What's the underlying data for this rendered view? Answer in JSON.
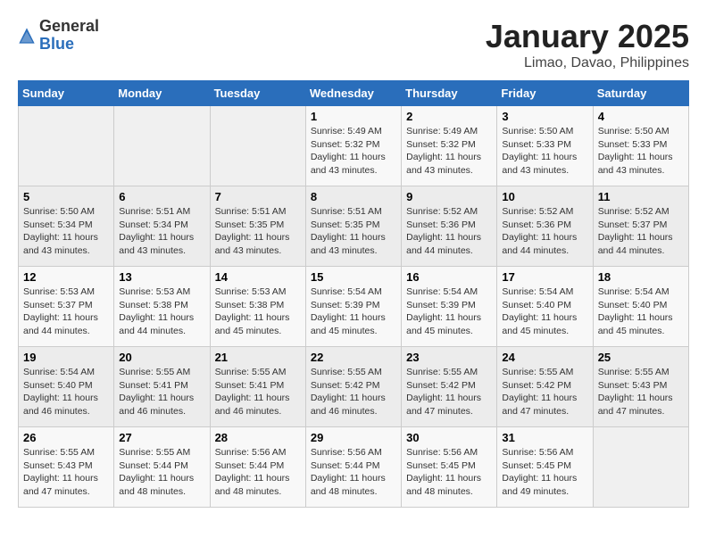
{
  "header": {
    "logo_general": "General",
    "logo_blue": "Blue",
    "month_title": "January 2025",
    "location": "Limao, Davao, Philippines"
  },
  "weekdays": [
    "Sunday",
    "Monday",
    "Tuesday",
    "Wednesday",
    "Thursday",
    "Friday",
    "Saturday"
  ],
  "weeks": [
    [
      {
        "day": "",
        "info": ""
      },
      {
        "day": "",
        "info": ""
      },
      {
        "day": "",
        "info": ""
      },
      {
        "day": "1",
        "info": "Sunrise: 5:49 AM\nSunset: 5:32 PM\nDaylight: 11 hours\nand 43 minutes."
      },
      {
        "day": "2",
        "info": "Sunrise: 5:49 AM\nSunset: 5:32 PM\nDaylight: 11 hours\nand 43 minutes."
      },
      {
        "day": "3",
        "info": "Sunrise: 5:50 AM\nSunset: 5:33 PM\nDaylight: 11 hours\nand 43 minutes."
      },
      {
        "day": "4",
        "info": "Sunrise: 5:50 AM\nSunset: 5:33 PM\nDaylight: 11 hours\nand 43 minutes."
      }
    ],
    [
      {
        "day": "5",
        "info": "Sunrise: 5:50 AM\nSunset: 5:34 PM\nDaylight: 11 hours\nand 43 minutes."
      },
      {
        "day": "6",
        "info": "Sunrise: 5:51 AM\nSunset: 5:34 PM\nDaylight: 11 hours\nand 43 minutes."
      },
      {
        "day": "7",
        "info": "Sunrise: 5:51 AM\nSunset: 5:35 PM\nDaylight: 11 hours\nand 43 minutes."
      },
      {
        "day": "8",
        "info": "Sunrise: 5:51 AM\nSunset: 5:35 PM\nDaylight: 11 hours\nand 43 minutes."
      },
      {
        "day": "9",
        "info": "Sunrise: 5:52 AM\nSunset: 5:36 PM\nDaylight: 11 hours\nand 44 minutes."
      },
      {
        "day": "10",
        "info": "Sunrise: 5:52 AM\nSunset: 5:36 PM\nDaylight: 11 hours\nand 44 minutes."
      },
      {
        "day": "11",
        "info": "Sunrise: 5:52 AM\nSunset: 5:37 PM\nDaylight: 11 hours\nand 44 minutes."
      }
    ],
    [
      {
        "day": "12",
        "info": "Sunrise: 5:53 AM\nSunset: 5:37 PM\nDaylight: 11 hours\nand 44 minutes."
      },
      {
        "day": "13",
        "info": "Sunrise: 5:53 AM\nSunset: 5:38 PM\nDaylight: 11 hours\nand 44 minutes."
      },
      {
        "day": "14",
        "info": "Sunrise: 5:53 AM\nSunset: 5:38 PM\nDaylight: 11 hours\nand 45 minutes."
      },
      {
        "day": "15",
        "info": "Sunrise: 5:54 AM\nSunset: 5:39 PM\nDaylight: 11 hours\nand 45 minutes."
      },
      {
        "day": "16",
        "info": "Sunrise: 5:54 AM\nSunset: 5:39 PM\nDaylight: 11 hours\nand 45 minutes."
      },
      {
        "day": "17",
        "info": "Sunrise: 5:54 AM\nSunset: 5:40 PM\nDaylight: 11 hours\nand 45 minutes."
      },
      {
        "day": "18",
        "info": "Sunrise: 5:54 AM\nSunset: 5:40 PM\nDaylight: 11 hours\nand 45 minutes."
      }
    ],
    [
      {
        "day": "19",
        "info": "Sunrise: 5:54 AM\nSunset: 5:40 PM\nDaylight: 11 hours\nand 46 minutes."
      },
      {
        "day": "20",
        "info": "Sunrise: 5:55 AM\nSunset: 5:41 PM\nDaylight: 11 hours\nand 46 minutes."
      },
      {
        "day": "21",
        "info": "Sunrise: 5:55 AM\nSunset: 5:41 PM\nDaylight: 11 hours\nand 46 minutes."
      },
      {
        "day": "22",
        "info": "Sunrise: 5:55 AM\nSunset: 5:42 PM\nDaylight: 11 hours\nand 46 minutes."
      },
      {
        "day": "23",
        "info": "Sunrise: 5:55 AM\nSunset: 5:42 PM\nDaylight: 11 hours\nand 47 minutes."
      },
      {
        "day": "24",
        "info": "Sunrise: 5:55 AM\nSunset: 5:42 PM\nDaylight: 11 hours\nand 47 minutes."
      },
      {
        "day": "25",
        "info": "Sunrise: 5:55 AM\nSunset: 5:43 PM\nDaylight: 11 hours\nand 47 minutes."
      }
    ],
    [
      {
        "day": "26",
        "info": "Sunrise: 5:55 AM\nSunset: 5:43 PM\nDaylight: 11 hours\nand 47 minutes."
      },
      {
        "day": "27",
        "info": "Sunrise: 5:55 AM\nSunset: 5:44 PM\nDaylight: 11 hours\nand 48 minutes."
      },
      {
        "day": "28",
        "info": "Sunrise: 5:56 AM\nSunset: 5:44 PM\nDaylight: 11 hours\nand 48 minutes."
      },
      {
        "day": "29",
        "info": "Sunrise: 5:56 AM\nSunset: 5:44 PM\nDaylight: 11 hours\nand 48 minutes."
      },
      {
        "day": "30",
        "info": "Sunrise: 5:56 AM\nSunset: 5:45 PM\nDaylight: 11 hours\nand 48 minutes."
      },
      {
        "day": "31",
        "info": "Sunrise: 5:56 AM\nSunset: 5:45 PM\nDaylight: 11 hours\nand 49 minutes."
      },
      {
        "day": "",
        "info": ""
      }
    ]
  ]
}
